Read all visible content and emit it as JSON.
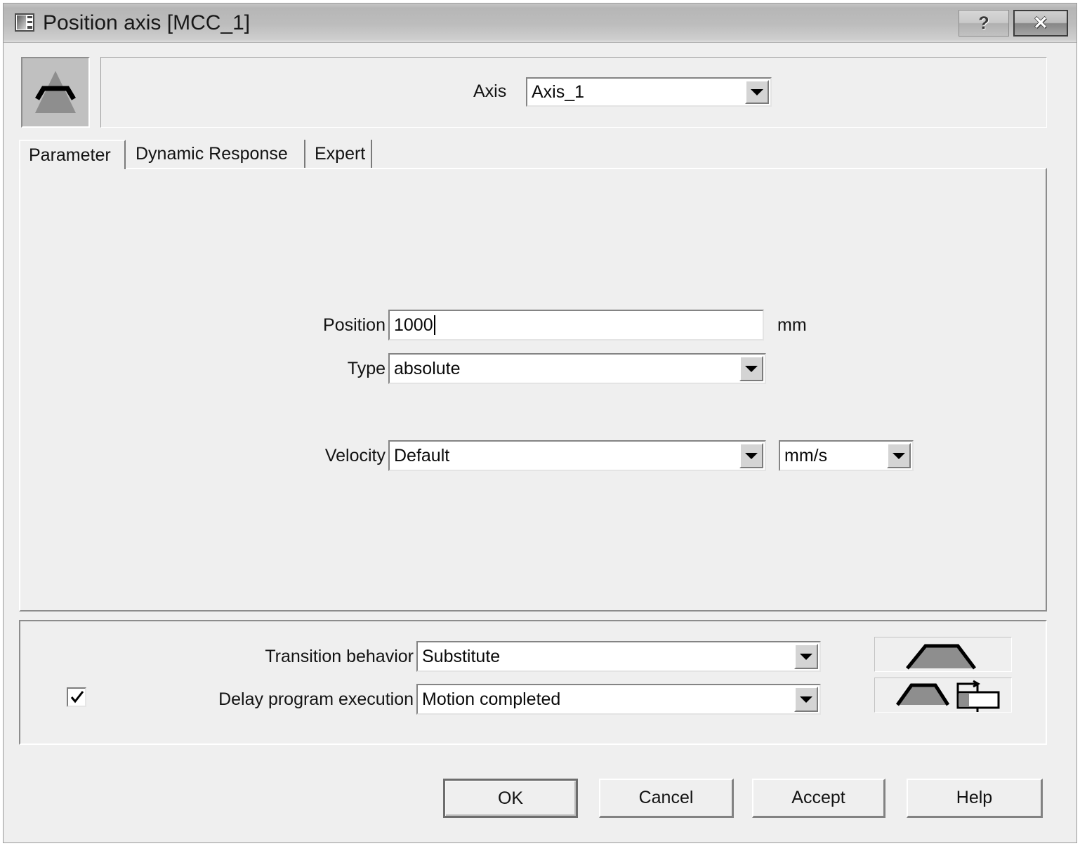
{
  "window": {
    "title": "Position axis [MCC_1]",
    "icon": "dialog-window-icon",
    "help_button": "?",
    "close_button": "✕"
  },
  "header": {
    "motion_profile_icon": "trapezoid-motion-profile-icon",
    "axis_label": "Axis",
    "axis_value": "Axis_1"
  },
  "tabs": [
    {
      "label": "Parameter",
      "active": true
    },
    {
      "label": "Dynamic Response",
      "active": false
    },
    {
      "label": "Expert",
      "active": false
    }
  ],
  "parameters": {
    "position_label": "Position",
    "position_value": "1000",
    "position_unit": "mm",
    "type_label": "Type",
    "type_value": "absolute",
    "velocity_label": "Velocity",
    "velocity_value": "Default",
    "velocity_unit_value": "mm/s"
  },
  "bottom": {
    "transition_label": "Transition behavior",
    "transition_value": "Substitute",
    "delay_label": "Delay program execution",
    "delay_value": "Motion completed",
    "delay_checked": true,
    "transition_preview_icon": "trapezoid-profile-icon",
    "delay_preview_icon": "trapezoid-with-program-block-icon"
  },
  "actions": {
    "ok": "OK",
    "cancel": "Cancel",
    "accept": "Accept",
    "help": "Help"
  },
  "colors": {
    "dialog_background": "#efefef",
    "titlebar_top": "#b6b6b6",
    "titlebar_bottom": "#dedede",
    "field_background": "#ffffff",
    "text": "#121212",
    "shape_fill": "#8e8e8e",
    "border_dark": "#848484"
  }
}
